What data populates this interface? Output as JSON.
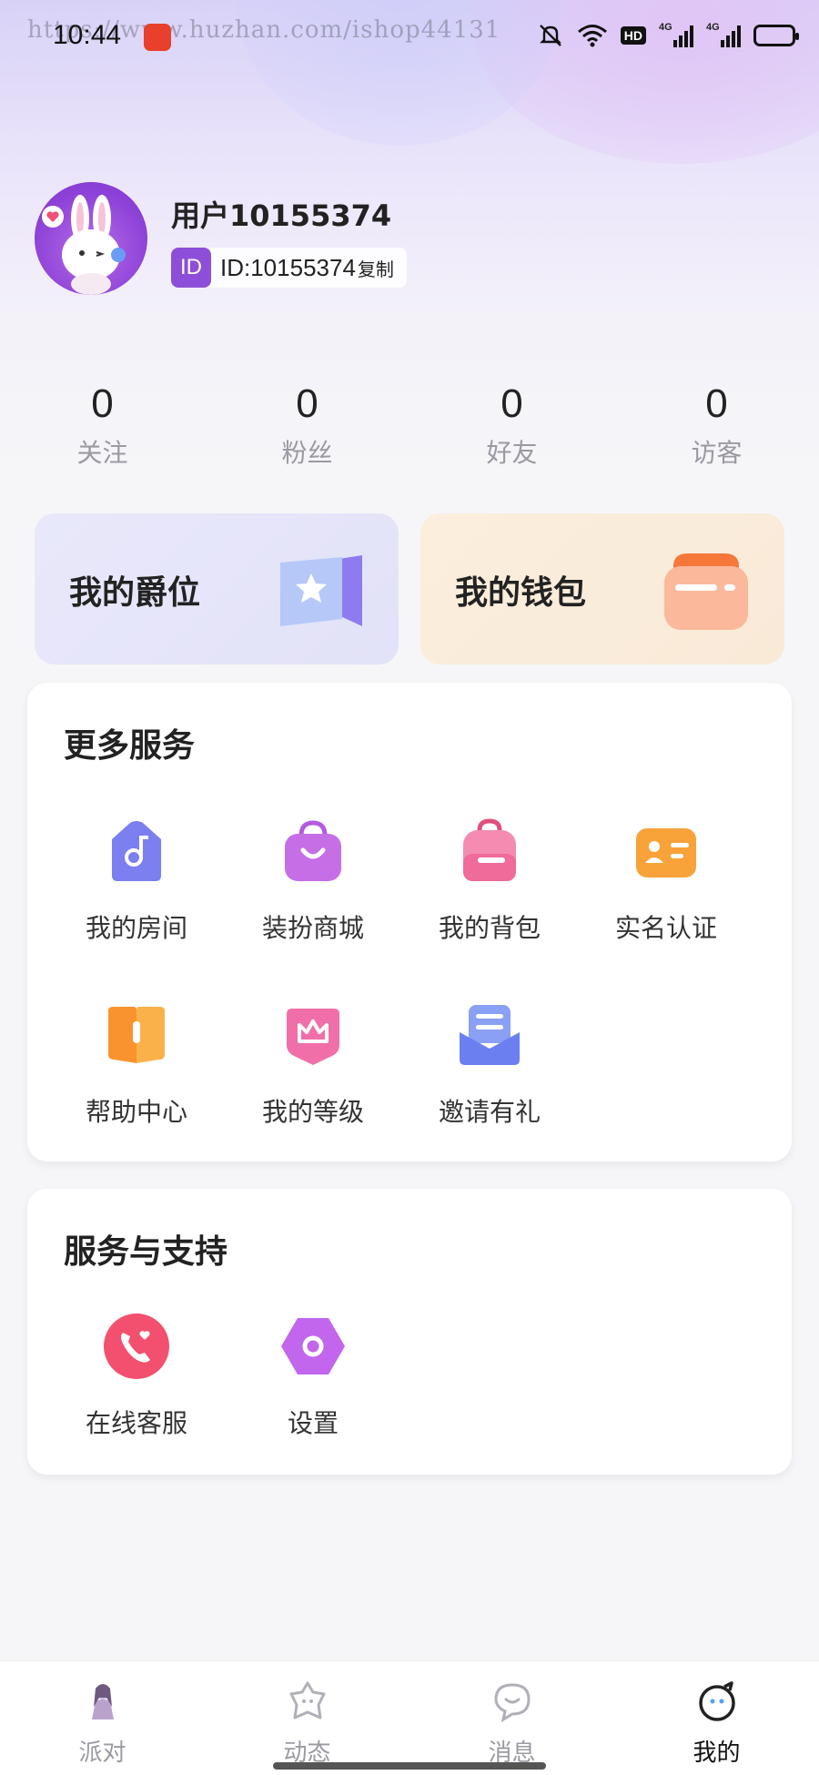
{
  "status_bar": {
    "time": "10:44",
    "watermark": "https://www.huzhan.com/ishop44131",
    "hd_label": "HD",
    "network_1": "4G",
    "network_2": "4G",
    "battery_level": 1.0
  },
  "profile": {
    "username": "用户10155374",
    "id_tag": "ID",
    "id_text": "ID:10155374",
    "copy_label": "复制"
  },
  "stats": [
    {
      "value": "0",
      "label": "关注"
    },
    {
      "value": "0",
      "label": "粉丝"
    },
    {
      "value": "0",
      "label": "好友"
    },
    {
      "value": "0",
      "label": "访客"
    }
  ],
  "feature_cards": {
    "rank": {
      "title": "我的爵位",
      "icon": "star-flag-icon"
    },
    "wallet": {
      "title": "我的钱包",
      "icon": "wallet-icon"
    }
  },
  "more_services": {
    "title": "更多服务",
    "items": [
      {
        "label": "我的房间",
        "icon": "music-room-icon",
        "color": "#7b7ff0"
      },
      {
        "label": "装扮商城",
        "icon": "shopping-bag-icon",
        "color": "#c66ee6"
      },
      {
        "label": "我的背包",
        "icon": "backpack-icon",
        "color": "#f06a9a"
      },
      {
        "label": "实名认证",
        "icon": "id-card-icon",
        "color": "#f8a23a"
      },
      {
        "label": "帮助中心",
        "icon": "help-book-icon",
        "color": "#f9932e"
      },
      {
        "label": "我的等级",
        "icon": "crown-icon",
        "color": "#f06fa8"
      },
      {
        "label": "邀请有礼",
        "icon": "invite-mail-icon",
        "color": "#6b7ff0"
      }
    ]
  },
  "support": {
    "title": "服务与支持",
    "items": [
      {
        "label": "在线客服",
        "icon": "phone-heart-icon",
        "color": "#f2506e"
      },
      {
        "label": "设置",
        "icon": "settings-hexagon-icon",
        "color": "#c266ee"
      }
    ]
  },
  "bottom_nav": [
    {
      "label": "派对",
      "icon": "party-icon",
      "active": false
    },
    {
      "label": "动态",
      "icon": "moments-icon",
      "active": false
    },
    {
      "label": "消息",
      "icon": "message-icon",
      "active": false
    },
    {
      "label": "我的",
      "icon": "profile-face-icon",
      "active": true
    }
  ]
}
